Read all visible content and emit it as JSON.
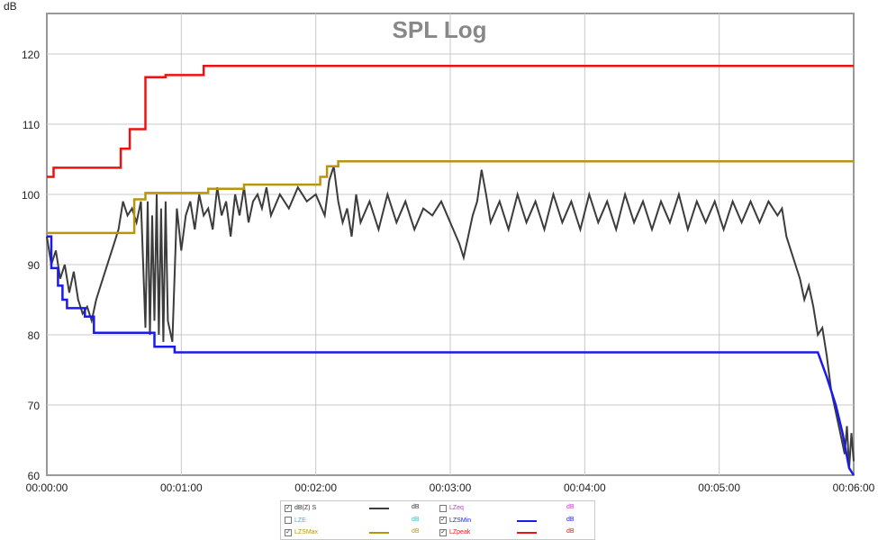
{
  "chart_data": {
    "type": "line",
    "title": "SPL Log",
    "ylabel": "dB",
    "xlabel": "",
    "ylim": [
      60,
      125
    ],
    "xlim": [
      0,
      360
    ],
    "yticks": [
      60,
      70,
      80,
      90,
      100,
      110,
      120
    ],
    "xticks": [
      0,
      60,
      120,
      180,
      240,
      300,
      360
    ],
    "xtick_labels": [
      "00:00:00",
      "00:01:00",
      "00:02:00",
      "00:03:00",
      "00:04:00",
      "00:05:00",
      "00:06:00"
    ],
    "grid": true,
    "legend_placement": "bottom-center",
    "series": [
      {
        "name": "dB(Z) S",
        "color": "#3c3c3c",
        "unit": "dB",
        "checked": true,
        "t": [
          0,
          2,
          4,
          6,
          8,
          10,
          12,
          14,
          16,
          18,
          20,
          22,
          24,
          26,
          28,
          30,
          32,
          34,
          36,
          38,
          40,
          42,
          44,
          45,
          46,
          47,
          48,
          49,
          50,
          51,
          52,
          53,
          54,
          56,
          58,
          60,
          62,
          64,
          66,
          68,
          70,
          72,
          74,
          76,
          78,
          80,
          82,
          84,
          86,
          88,
          90,
          92,
          94,
          96,
          98,
          100,
          104,
          108,
          112,
          116,
          120,
          124,
          126,
          128,
          130,
          132,
          134,
          136,
          138,
          140,
          144,
          148,
          152,
          156,
          160,
          164,
          168,
          172,
          176,
          180,
          184,
          186,
          188,
          190,
          192,
          194,
          196,
          198,
          202,
          206,
          210,
          214,
          218,
          222,
          226,
          230,
          234,
          238,
          242,
          246,
          250,
          254,
          258,
          262,
          266,
          270,
          274,
          278,
          282,
          286,
          290,
          294,
          298,
          302,
          306,
          310,
          314,
          318,
          322,
          326,
          328,
          330,
          332,
          334,
          336,
          338,
          340,
          342,
          344,
          346,
          348,
          350,
          352,
          354,
          356,
          357,
          358,
          359,
          360
        ],
        "values": [
          94,
          90,
          92,
          88,
          90,
          86,
          89,
          85,
          83,
          84,
          82,
          85,
          87,
          89,
          91,
          93,
          95,
          99,
          97,
          98,
          96,
          99,
          81,
          99,
          80,
          97,
          82,
          100,
          80,
          98,
          79,
          99,
          82,
          79,
          98,
          92,
          97,
          99,
          95,
          100,
          97,
          98,
          95,
          101,
          97,
          99,
          94,
          100,
          97,
          101,
          96,
          99,
          100,
          98,
          101,
          97,
          100,
          98,
          101,
          99,
          100,
          97,
          102,
          104,
          99,
          96,
          98,
          94,
          100,
          96,
          99,
          95,
          100,
          96,
          99,
          95,
          98,
          97,
          99,
          96,
          93,
          91,
          94,
          97,
          99,
          103.5,
          100,
          96,
          99,
          95,
          100,
          96,
          99,
          95,
          100,
          96,
          99,
          95,
          100,
          96,
          99,
          95,
          100,
          96,
          99,
          95,
          99,
          96,
          100,
          95,
          99,
          96,
          99,
          95,
          99,
          96,
          99,
          96,
          99,
          97,
          98,
          94,
          92,
          90,
          88,
          85,
          87,
          84,
          80,
          81,
          77,
          72,
          69,
          66,
          63,
          67,
          61,
          66,
          62
        ]
      },
      {
        "name": "LZeq",
        "color": "#cc33cc",
        "unit": "dB",
        "checked": false,
        "t": [],
        "values": []
      },
      {
        "name": "LZE",
        "color": "#33bbcc",
        "unit": "dB",
        "checked": false,
        "t": [],
        "values": []
      },
      {
        "name": "LZSMin",
        "color": "#1a1aee",
        "unit": "dB",
        "checked": true,
        "t": [
          0,
          2,
          5,
          7,
          9,
          17,
          21,
          48,
          57,
          344,
          348,
          352,
          355,
          358,
          360
        ],
        "values": [
          94,
          89.5,
          87,
          85,
          83.8,
          82.6,
          80.3,
          78.3,
          77.5,
          77.5,
          74,
          70,
          66,
          61,
          60
        ]
      },
      {
        "name": "LZSMax",
        "color": "#b8960c",
        "unit": "dB",
        "checked": true,
        "t": [
          0,
          35,
          39,
          44,
          72,
          88,
          122,
          125,
          130,
          132,
          360
        ],
        "values": [
          94.5,
          94.5,
          99.3,
          100.2,
          100.8,
          101.4,
          102.5,
          104,
          104.7,
          104.7,
          104.7
        ]
      },
      {
        "name": "LZpeak",
        "color": "#ee1111",
        "unit": "dB",
        "checked": true,
        "t": [
          0,
          3,
          33,
          34,
          37,
          44,
          53,
          70,
          360
        ],
        "values": [
          102.5,
          103.8,
          106.5,
          106.5,
          109.3,
          116.7,
          117,
          118.3,
          118.3
        ]
      }
    ]
  }
}
